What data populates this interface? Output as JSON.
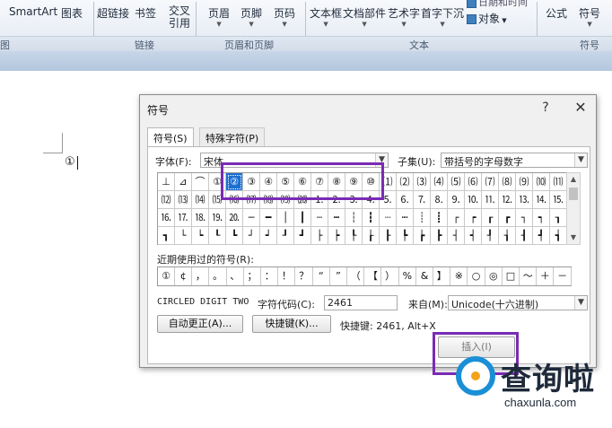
{
  "ribbon": {
    "items": [
      "SmartArt",
      "图表",
      "超链接",
      "书签",
      "页眉",
      "页脚",
      "页码",
      "文本框",
      "文档部件",
      "艺术字",
      "首字下沉",
      "公式",
      "符号"
    ],
    "cross_ref_line1": "交叉",
    "cross_ref_line2": "引用",
    "datetime_partial": "日期和时间",
    "object_label": "对象",
    "group_labels": [
      "图",
      "链接",
      "页眉和页脚",
      "文本",
      "符号"
    ]
  },
  "document": {
    "inserted_char": "①"
  },
  "dialog": {
    "title": "符号",
    "help": "?",
    "close": "✕",
    "tabs": [
      "符号(S)",
      "特殊字符(P)"
    ],
    "font_label": "字体(F):",
    "font_value": "宋体",
    "subset_label": "子集(U):",
    "subset_value": "带括号的字母数字",
    "grid_rows": [
      [
        "⊥",
        "⊿",
        "⌒",
        "①",
        "②",
        "③",
        "④",
        "⑤",
        "⑥",
        "⑦",
        "⑧",
        "⑨",
        "⑩",
        "⑴",
        "⑵",
        "⑶",
        "⑷",
        "⑸",
        "⑹",
        "⑺",
        "⑻",
        "⑼",
        "⑽",
        "⑾"
      ],
      [
        "⑿",
        "⒀",
        "⒁",
        "⒂",
        "⒃",
        "⒄",
        "⒅",
        "⒆",
        "⒇",
        "⒈",
        "⒉",
        "⒊",
        "⒋",
        "⒌",
        "⒍",
        "⒎",
        "⒏",
        "⒐",
        "⒑",
        "⒒",
        "⒓",
        "⒔",
        "⒕",
        "⒖"
      ],
      [
        "⒗",
        "⒘",
        "⒙",
        "⒚",
        "⒛",
        "─",
        "━",
        "│",
        "┃",
        "┄",
        "┅",
        "┆",
        "┇",
        "┈",
        "┉",
        "┊",
        "┋",
        "┌",
        "┍",
        "┎",
        "┏",
        "┐",
        "┑",
        "┒"
      ],
      [
        "┓",
        "└",
        "┕",
        "┖",
        "┗",
        "┘",
        "┙",
        "┚",
        "┛",
        "├",
        "┝",
        "┞",
        "┟",
        "┠",
        "┡",
        "┢",
        "┣",
        "┤",
        "┥",
        "┦",
        "┧",
        "┨",
        "┩",
        "┪"
      ]
    ],
    "selected_symbol": "②",
    "recent_label": "近期使用过的符号(R):",
    "recent_symbols": [
      "①",
      "¢",
      "，",
      "。",
      "、",
      "；",
      "：",
      "！",
      "？",
      "“",
      "”",
      "（",
      "【",
      "）",
      "%",
      "&",
      "】",
      "※",
      "○",
      "◎",
      "□",
      "～",
      "＋",
      "－"
    ],
    "char_name": "CIRCLED DIGIT TWO",
    "code_label": "字符代码(C):",
    "code_value": "2461",
    "from_label": "来自(M):",
    "from_value": "Unicode(十六进制)",
    "autocorrect_button": "自动更正(A)...",
    "shortcut_button": "快捷键(K)...",
    "shortcut_text": "快捷键: 2461, Alt+X",
    "insert_button": "插入(I)"
  },
  "watermark": {
    "name": "查询啦",
    "url": "chaxunla.com"
  },
  "colors": {
    "selection": "#1b6fd1",
    "highlight": "#7a2bb5",
    "ribbon": "#e3e9f2"
  }
}
